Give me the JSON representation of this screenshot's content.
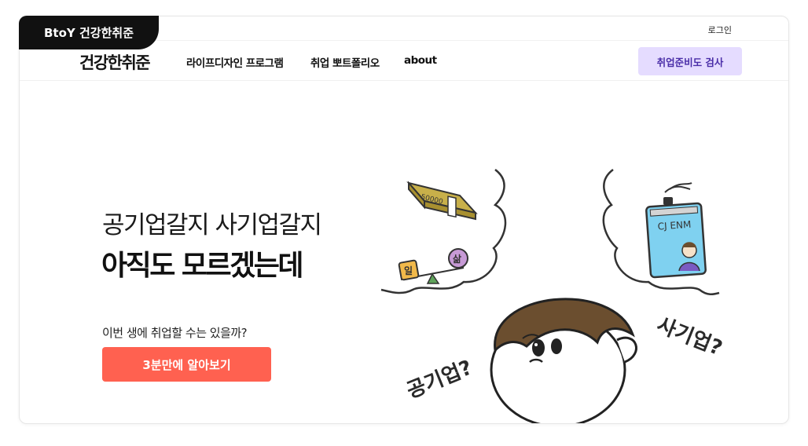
{
  "badge": {
    "label": "BtoY 건강한취준"
  },
  "topbar": {
    "login": "로그인"
  },
  "nav": {
    "logo": "건강한취준",
    "menu": [
      "라이프디자인 프로그램",
      "취업 뽀트폴리오",
      "about"
    ],
    "cta": "취업준비도 검사"
  },
  "hero": {
    "subtitle": "공기업갈지 사기업갈지",
    "title": "아직도 모르겠는데",
    "question": "이번 생에 취업할 수는 있을까?",
    "cta": "3분만에 알아보기"
  },
  "illustration": {
    "left_text": "공기업?",
    "right_text": "사기업?",
    "money_label": "50000",
    "scale_left": "일",
    "scale_right": "삶",
    "badge_title": "CJ ENM",
    "colors": {
      "hair": "#6b4e2f",
      "money": "#c8b04a",
      "card": "#7fd1f0",
      "scale_left": "#f1b94a",
      "scale_right": "#c79ad6",
      "pivot": "#5fa35a"
    }
  },
  "colors": {
    "primary": "#ff6150",
    "accent_bg": "#e5dcff",
    "accent_text": "#4a2ea8",
    "badge": "#111111"
  }
}
